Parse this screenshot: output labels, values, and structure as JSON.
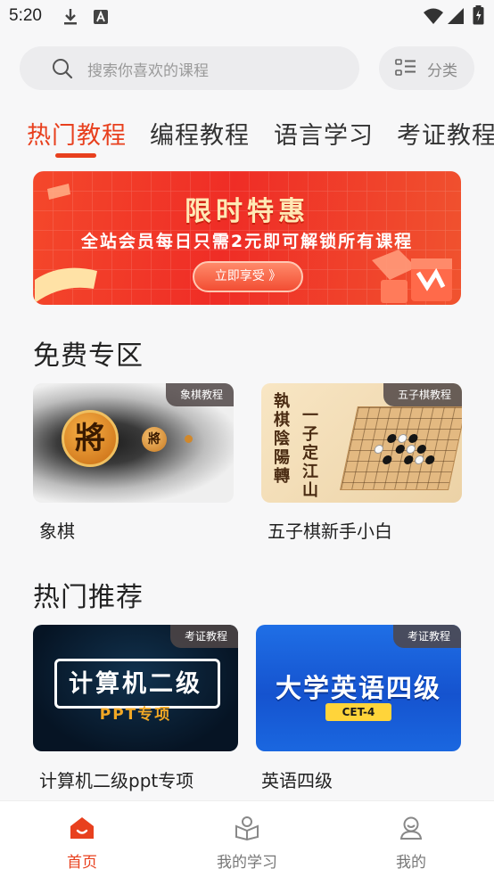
{
  "status_bar": {
    "time": "5:20"
  },
  "search": {
    "placeholder": "搜索你喜欢的课程"
  },
  "category_button": {
    "label": "分类"
  },
  "tabs": [
    {
      "label": "热门教程",
      "active": true
    },
    {
      "label": "编程教程",
      "active": false
    },
    {
      "label": "语言学习",
      "active": false
    },
    {
      "label": "考证教程",
      "active": false
    }
  ],
  "banner": {
    "title": "限时特惠",
    "subtitle": "全站会员每日只需2元即可解锁所有课程",
    "button_label": "立即享受 》"
  },
  "free_section": {
    "title": "免费专区",
    "items": [
      {
        "tag": "象棋教程",
        "title": "象棋",
        "art_big": "將",
        "art_small": "將"
      },
      {
        "tag": "五子棋教程",
        "title": "五子棋新手小白",
        "art_left": "執棋陰陽轉",
        "art_right": "一子定江山"
      }
    ]
  },
  "hot_section": {
    "title": "热门推荐",
    "items": [
      {
        "tag": "考证教程",
        "title": "计算机二级ppt专项",
        "art_title": "计算机二级",
        "art_sub": "PPT专项"
      },
      {
        "tag": "考证教程",
        "title": "英语四级",
        "art_title": "大学英语四级",
        "art_badge": "CET-4"
      }
    ]
  },
  "bottom_nav": [
    {
      "label": "首页",
      "icon": "home-icon",
      "active": true
    },
    {
      "label": "我的学习",
      "icon": "study-icon",
      "active": false
    },
    {
      "label": "我的",
      "icon": "profile-icon",
      "active": false
    }
  ],
  "colors": {
    "accent": "#e8401e",
    "banner": "#ef2d26"
  }
}
